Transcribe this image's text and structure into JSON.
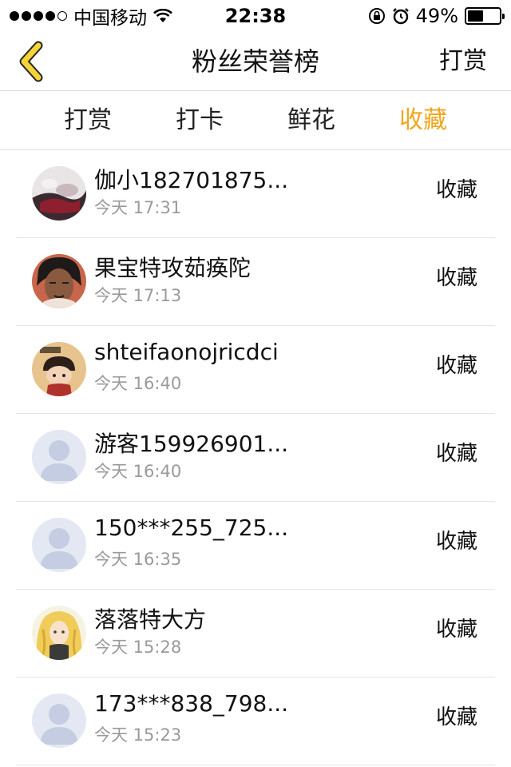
{
  "status_bar": {
    "carrier": "中国移动",
    "time": "22:38",
    "battery": "49%",
    "battery_level": 0.49,
    "icons": [
      "signal-dots",
      "wifi-icon",
      "orientation-lock-icon",
      "alarm-icon",
      "battery-icon"
    ]
  },
  "nav": {
    "back_icon": "chevron-left-icon",
    "title": "粉丝荣誉榜",
    "right": "打赏"
  },
  "tabs": [
    {
      "label": "打赏",
      "active": false
    },
    {
      "label": "打卡",
      "active": false
    },
    {
      "label": "鲜花",
      "active": false
    },
    {
      "label": "收藏",
      "active": true
    }
  ],
  "colors": {
    "accent": "#f2a51c",
    "back_icon": "#f5d43a",
    "divider": "#e4e4e4",
    "secondary_text": "#9a9a9a"
  },
  "list": [
    {
      "name": "伽小182701875...",
      "time": "今天 17:31",
      "action": "收藏",
      "avatar": "photo-avatar"
    },
    {
      "name": "果宝特攻茹痪陀",
      "time": "今天 17:13",
      "action": "收藏",
      "avatar": "illustration-avatar"
    },
    {
      "name": "shteifaonojricdci",
      "time": "今天 16:40",
      "action": "收藏",
      "avatar": "cartoon-avatar"
    },
    {
      "name": "游客159926901...",
      "time": "今天 16:40",
      "action": "收藏",
      "avatar": "default-user-avatar"
    },
    {
      "name": "150***255_725...",
      "time": "今天 16:35",
      "action": "收藏",
      "avatar": "default-user-avatar"
    },
    {
      "name": "落落特大方",
      "time": "今天 15:28",
      "action": "收藏",
      "avatar": "anime-avatar"
    },
    {
      "name": "173***838_798...",
      "time": "今天 15:23",
      "action": "收藏",
      "avatar": "default-user-avatar"
    }
  ]
}
